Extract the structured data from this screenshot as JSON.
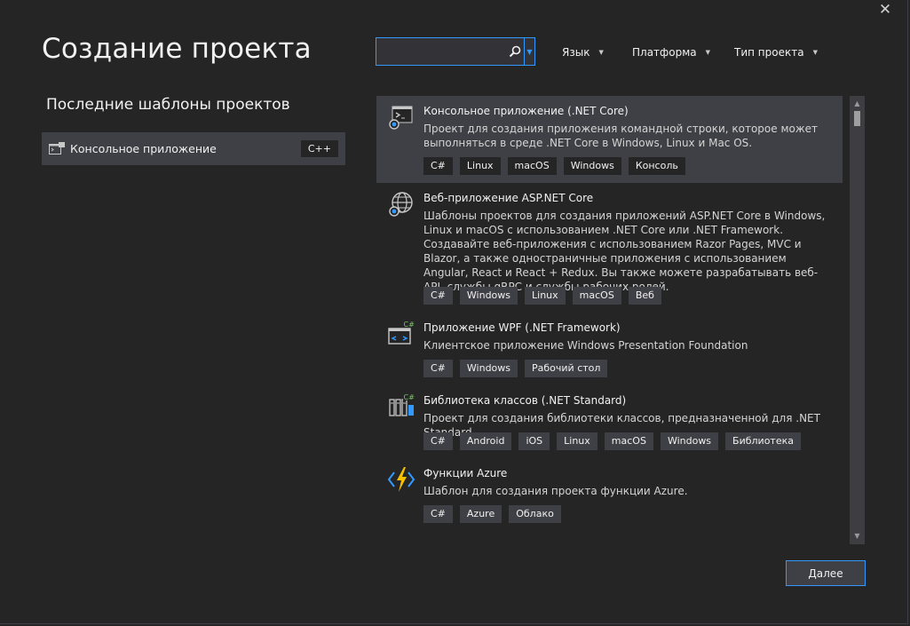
{
  "title": "Создание проекта",
  "close_glyph": "✕",
  "recent": {
    "heading": "Последние шаблоны проектов",
    "items": [
      {
        "name": "Консольное приложение",
        "language": "C++",
        "icon": "console-app-icon"
      }
    ]
  },
  "search": {
    "value": "",
    "placeholder": ""
  },
  "filters": {
    "language": "Язык",
    "platform": "Платформа",
    "project_type": "Тип проекта"
  },
  "templates": [
    {
      "name": "Консольное приложение (.NET Core)",
      "icon": "console-app-icon",
      "desc": "Проект для создания приложения командной строки, которое может выполняться в среде .NET Core в Windows, Linux и Mac OS.",
      "tags": [
        "C#",
        "Linux",
        "macOS",
        "Windows",
        "Консоль"
      ],
      "selected": true
    },
    {
      "name": "Веб-приложение ASP.NET Core",
      "icon": "globe-icon",
      "desc": "Шаблоны проектов для создания приложений ASP.NET Core в Windows, Linux и macOS с использованием .NET Core или .NET Framework. Создавайте веб-приложения с использованием Razor Pages, MVC и Blazor, а также одностраничные приложения с использованием Angular, React и React + Redux. Вы также можете разрабатывать веб-API, службы gRPC и службы рабочих ролей.",
      "tags": [
        "C#",
        "Windows",
        "Linux",
        "macOS",
        "Веб"
      ],
      "selected": false
    },
    {
      "name": "Приложение WPF (.NET Framework)",
      "icon": "wpf-app-icon",
      "desc": "Клиентское приложение Windows Presentation Foundation",
      "tags": [
        "C#",
        "Windows",
        "Рабочий стол"
      ],
      "selected": false
    },
    {
      "name": "Библиотека классов (.NET Standard)",
      "icon": "class-library-icon",
      "desc": "Проект для создания библиотеки классов, предназначенной для .NET Standard.",
      "tags": [
        "C#",
        "Android",
        "iOS",
        "Linux",
        "macOS",
        "Windows",
        "Библиотека"
      ],
      "selected": false
    },
    {
      "name": "Функции Azure",
      "icon": "azure-functions-icon",
      "desc": "Шаблон для создания проекта функции Azure.",
      "tags": [
        "C#",
        "Azure",
        "Облако"
      ],
      "selected": false
    }
  ],
  "next_button": "Далее",
  "colors": {
    "accent": "#3399ff",
    "background": "#252526",
    "selected": "#3f3f46",
    "azure_bolt": "#f6c000"
  }
}
